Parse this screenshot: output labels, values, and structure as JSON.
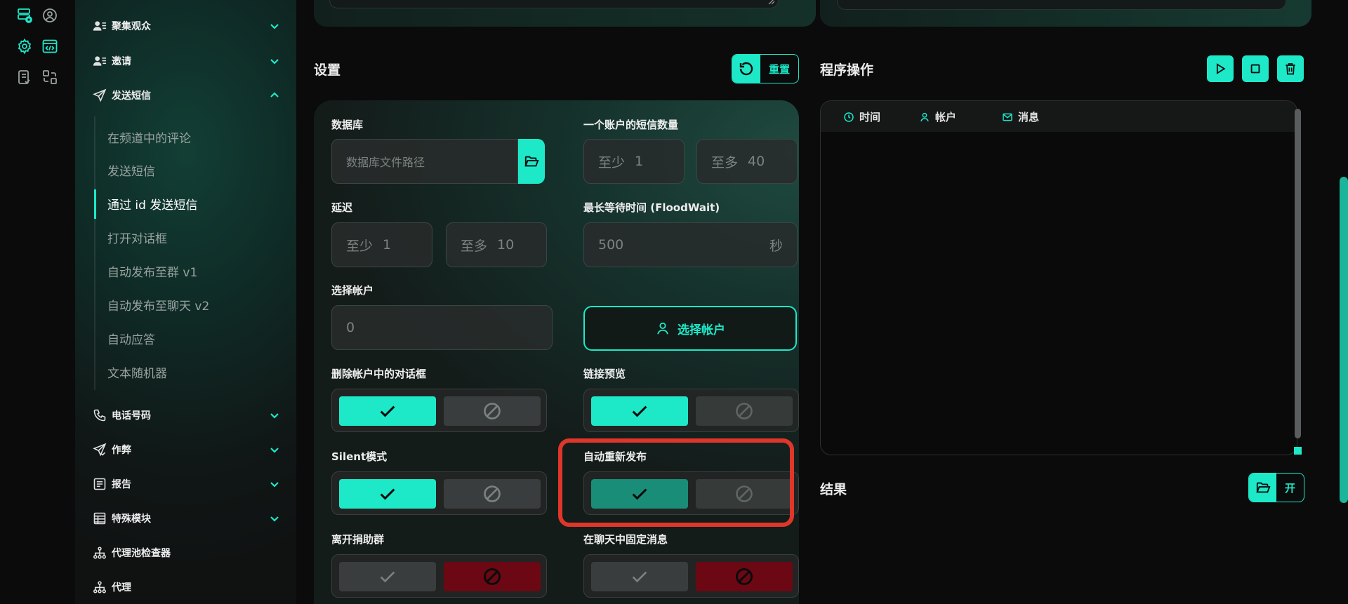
{
  "rail": {
    "icons": [
      "database-icon",
      "user-circle-icon",
      "gear-icon",
      "code-window-icon",
      "checklist-icon",
      "convert-icon"
    ]
  },
  "sidebar": {
    "groups": [
      {
        "label": "聚集观众",
        "icon": "users-list-icon",
        "state": "collapsed"
      },
      {
        "label": "邀请",
        "icon": "users-list-icon",
        "state": "collapsed"
      },
      {
        "label": "发送短信",
        "icon": "send-icon",
        "state": "expanded"
      },
      {
        "label": "电话号码",
        "icon": "phone-icon",
        "state": "collapsed"
      },
      {
        "label": "作弊",
        "icon": "send-check-icon",
        "state": "collapsed"
      },
      {
        "label": "报告",
        "icon": "report-icon",
        "state": "collapsed"
      },
      {
        "label": "特殊模块",
        "icon": "table-icon",
        "state": "collapsed"
      },
      {
        "label": "代理池检查器",
        "icon": "network-icon",
        "state": "none"
      },
      {
        "label": "代理",
        "icon": "network-icon",
        "state": "none"
      }
    ],
    "sub_items": [
      {
        "label": "在频道中的评论"
      },
      {
        "label": "发送短信"
      },
      {
        "label": "通过 id 发送短信",
        "active": true
      },
      {
        "label": "打开对话框"
      },
      {
        "label": "自动发布至群 v1"
      },
      {
        "label": "自动发布至聊天 v2"
      },
      {
        "label": "自动应答"
      },
      {
        "label": "文本随机器"
      }
    ]
  },
  "settings": {
    "title": "设置",
    "reset_label": "重置",
    "database": {
      "label": "数据库",
      "placeholder": "数据库文件路径"
    },
    "msgs_per_account": {
      "label": "一个账户的短信数量",
      "min_prefix": "至少",
      "min": "1",
      "max_prefix": "至多",
      "max": "40"
    },
    "delay": {
      "label": "延迟",
      "min_prefix": "至少",
      "min": "1",
      "max_prefix": "至多",
      "max": "10"
    },
    "flood_wait": {
      "label": "最长等待时间 (FloodWait)",
      "value": "500",
      "unit": "秒"
    },
    "accounts": {
      "label": "选择帐户",
      "value": "0",
      "button": "选择帐户"
    },
    "toggles": [
      {
        "label": "删除帐户中的对话框",
        "value": true
      },
      {
        "label": "链接预览",
        "value": true
      },
      {
        "label": "Silent模式",
        "value": true
      },
      {
        "label": "自动重新发布",
        "value": true,
        "highlighted": true
      },
      {
        "label": "离开捐助群",
        "value": false
      },
      {
        "label": "在聊天中固定消息",
        "value": false
      }
    ]
  },
  "program": {
    "title": "程序操作",
    "controls": [
      "play-icon",
      "stop-icon",
      "trash-icon"
    ],
    "columns": [
      "时间",
      "帐户",
      "消息"
    ]
  },
  "result": {
    "title": "结果",
    "open_label": "开"
  },
  "colors": {
    "accent": "#1de9c8",
    "accent_muted": "#1a8d78",
    "danger": "#6b0813",
    "highlight": "#e0362a"
  }
}
